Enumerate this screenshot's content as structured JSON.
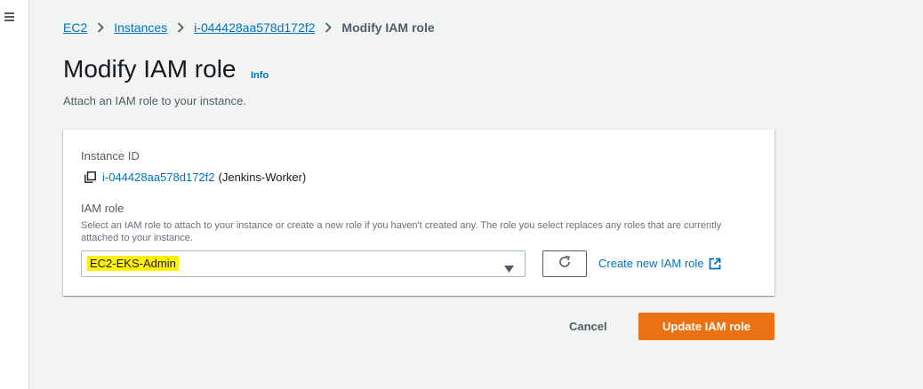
{
  "breadcrumb": {
    "items": [
      "EC2",
      "Instances",
      "i-044428aa578d172f2"
    ],
    "current": "Modify IAM role"
  },
  "page": {
    "title": "Modify IAM role",
    "info": "Info",
    "description": "Attach an IAM role to your instance."
  },
  "instance": {
    "label": "Instance ID",
    "id": "i-044428aa578d172f2",
    "name": "(Jenkins-Worker)"
  },
  "iam_role": {
    "label": "IAM role",
    "description": "Select an IAM role to attach to your instance or create a new role if you haven't created any. The role you select replaces any roles that are currently attached to your instance.",
    "selected": "EC2-EKS-Admin",
    "create_link": "Create new IAM role"
  },
  "actions": {
    "cancel": "Cancel",
    "update": "Update IAM role"
  },
  "icons": {
    "menu": "hamburger-menu-icon",
    "separator": "chevron-right-icon",
    "copy": "copy-icon",
    "dropdown": "caret-down-icon",
    "refresh": "refresh-icon",
    "external": "external-link-icon"
  },
  "colors": {
    "link": "#0073bb",
    "primary_button": "#ec7211",
    "highlight": "#fff200",
    "background": "#f2f3f3"
  }
}
